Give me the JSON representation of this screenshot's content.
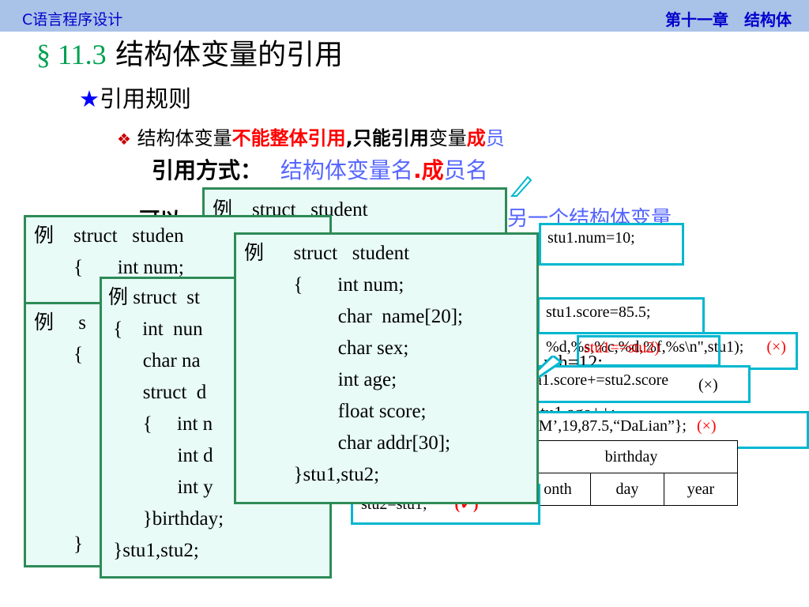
{
  "header": {
    "left": "C语言程序设计",
    "right": "第十一章　结构体"
  },
  "title": {
    "section": "§ 11.3",
    "text": " 结构体变量的引用"
  },
  "bullet1": {
    "star": "★",
    "text_a": "引用",
    "text_b": "规则"
  },
  "bullet2": {
    "diamond": "❖",
    "part1": "结构体变量",
    "part2": "不能整体引用",
    "part3": ",只能引用",
    "part4": "变量",
    "part5": "成",
    "part6": "员",
    "line2_label": "引用方式：",
    "line2_value_a": "结构体变量名",
    "line2_value_b": ".成",
    "line2_value_c": "员名"
  },
  "bullet3": {
    "diamond": "❖",
    "text_a": "可以",
    "text_b": "另一个结构体变量"
  },
  "assignments": {
    "num": "stu1.num=10;",
    "score": "stu1.score=85.5;",
    "printf": "%d,%s,%c,%d,%f,%s\\n\",stu1);",
    "printf_mark": "(×)",
    "stu_eq": "stu1==stu2)",
    "stu_eq_mark": "(×)",
    "month": "nth=12;",
    "score_add": "a1.score+=stu2.score",
    "score_add_mark": "(×)",
    "age": "tu1.age++;",
    "init": "‘M’,19,87.5,“DaLian”};",
    "init_mark": "(×)",
    "stu2": "stu2=stu1;",
    "stu2_mark": "(✓)"
  },
  "table": {
    "header": "birthday",
    "cells": [
      "onth",
      "day",
      "year"
    ]
  },
  "code_boxes": {
    "back": {
      "line1": "例    struct   student"
    },
    "left": {
      "line1": "例    struct   studen",
      "line2": "        {       int num;"
    },
    "left2": {
      "line1": "例     s",
      "line2": "        {",
      "line3": "        }"
    },
    "nested": {
      "line1": "例 struct  st",
      "line2": " {    int  nun",
      "line3": "       char na",
      "line4": "       struct  d",
      "line5": "       {     int n",
      "line6": "              int d",
      "line7": "              int y",
      "line8": "       }birthday;",
      "line9": " }stu1,stu2;"
    },
    "front": {
      "line1": "例      struct   student",
      "line2": "          {       int num;",
      "line3": "                   char  name[20];",
      "line4": "                   char sex;",
      "line5": "                   int age;",
      "line6": "                   float score;",
      "line7": "                   char addr[30];",
      "line8": "          }stu1,stu2;"
    }
  }
}
